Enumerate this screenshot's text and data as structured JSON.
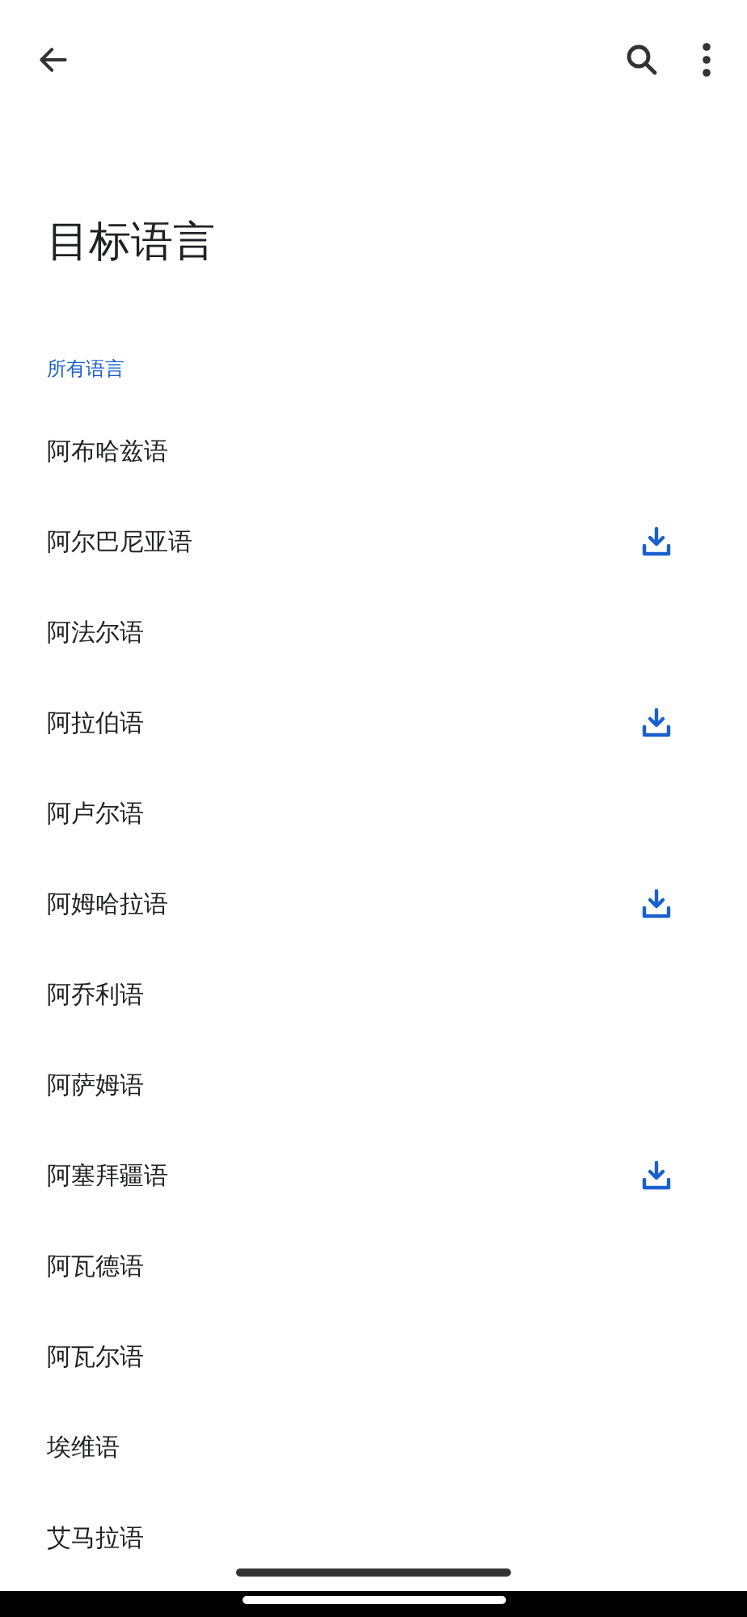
{
  "title": "目标语言",
  "section_label": "所有语言",
  "languages": [
    {
      "name": "阿布哈兹语",
      "downloadable": false
    },
    {
      "name": "阿尔巴尼亚语",
      "downloadable": true
    },
    {
      "name": "阿法尔语",
      "downloadable": false
    },
    {
      "name": "阿拉伯语",
      "downloadable": true
    },
    {
      "name": "阿卢尔语",
      "downloadable": false
    },
    {
      "name": "阿姆哈拉语",
      "downloadable": true
    },
    {
      "name": "阿乔利语",
      "downloadable": false
    },
    {
      "name": "阿萨姆语",
      "downloadable": false
    },
    {
      "name": "阿塞拜疆语",
      "downloadable": true
    },
    {
      "name": "阿瓦德语",
      "downloadable": false
    },
    {
      "name": "阿瓦尔语",
      "downloadable": false
    },
    {
      "name": "埃维语",
      "downloadable": false
    },
    {
      "name": "艾马拉语",
      "downloadable": false
    }
  ]
}
